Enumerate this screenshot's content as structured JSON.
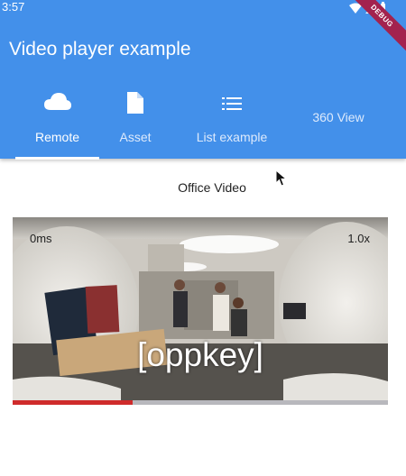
{
  "status_bar": {
    "time": "3:57",
    "debug_badge": "DEBUG"
  },
  "app_bar": {
    "title": "Video player example"
  },
  "tabs": [
    {
      "label": "Remote",
      "icon": "cloud-icon",
      "active": true
    },
    {
      "label": "Asset",
      "icon": "file-icon",
      "active": false
    },
    {
      "label": "List example",
      "icon": "list-icon",
      "active": false
    },
    {
      "label": "360 View",
      "icon": "",
      "active": false
    }
  ],
  "main": {
    "video_title": "Office Video",
    "player": {
      "position_label": "0ms",
      "speed_label": "1.0x",
      "caption": "[oppkey]",
      "progress": 0.32
    }
  },
  "colors": {
    "primary": "#4390ea",
    "progress": "#cf2b2b"
  }
}
